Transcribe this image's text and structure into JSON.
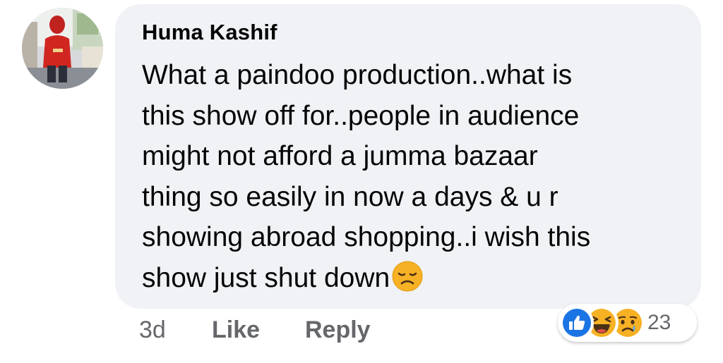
{
  "comment": {
    "author": "Huma Kashif",
    "text_lines": [
      "What a paindoo production..what is",
      "this show off for..people in audience",
      "might not afford a jumma bazaar",
      "thing so easily in now a days & u r",
      "showing abroad shopping..i wish this",
      "show just shut down"
    ],
    "trailing_emoji": "disappointed-face-emoji"
  },
  "actions": {
    "time": "3d",
    "like_label": "Like",
    "reply_label": "Reply"
  },
  "reactions": {
    "icons": [
      "like-reaction-icon",
      "haha-reaction-icon",
      "sad-reaction-icon"
    ],
    "count": "23"
  },
  "colors": {
    "bubble_bg": "#f0f2f5",
    "text": "#050505",
    "secondary_text": "#65676b",
    "like_blue": "#1b74e4",
    "emoji_yellow": "#f7b125"
  }
}
